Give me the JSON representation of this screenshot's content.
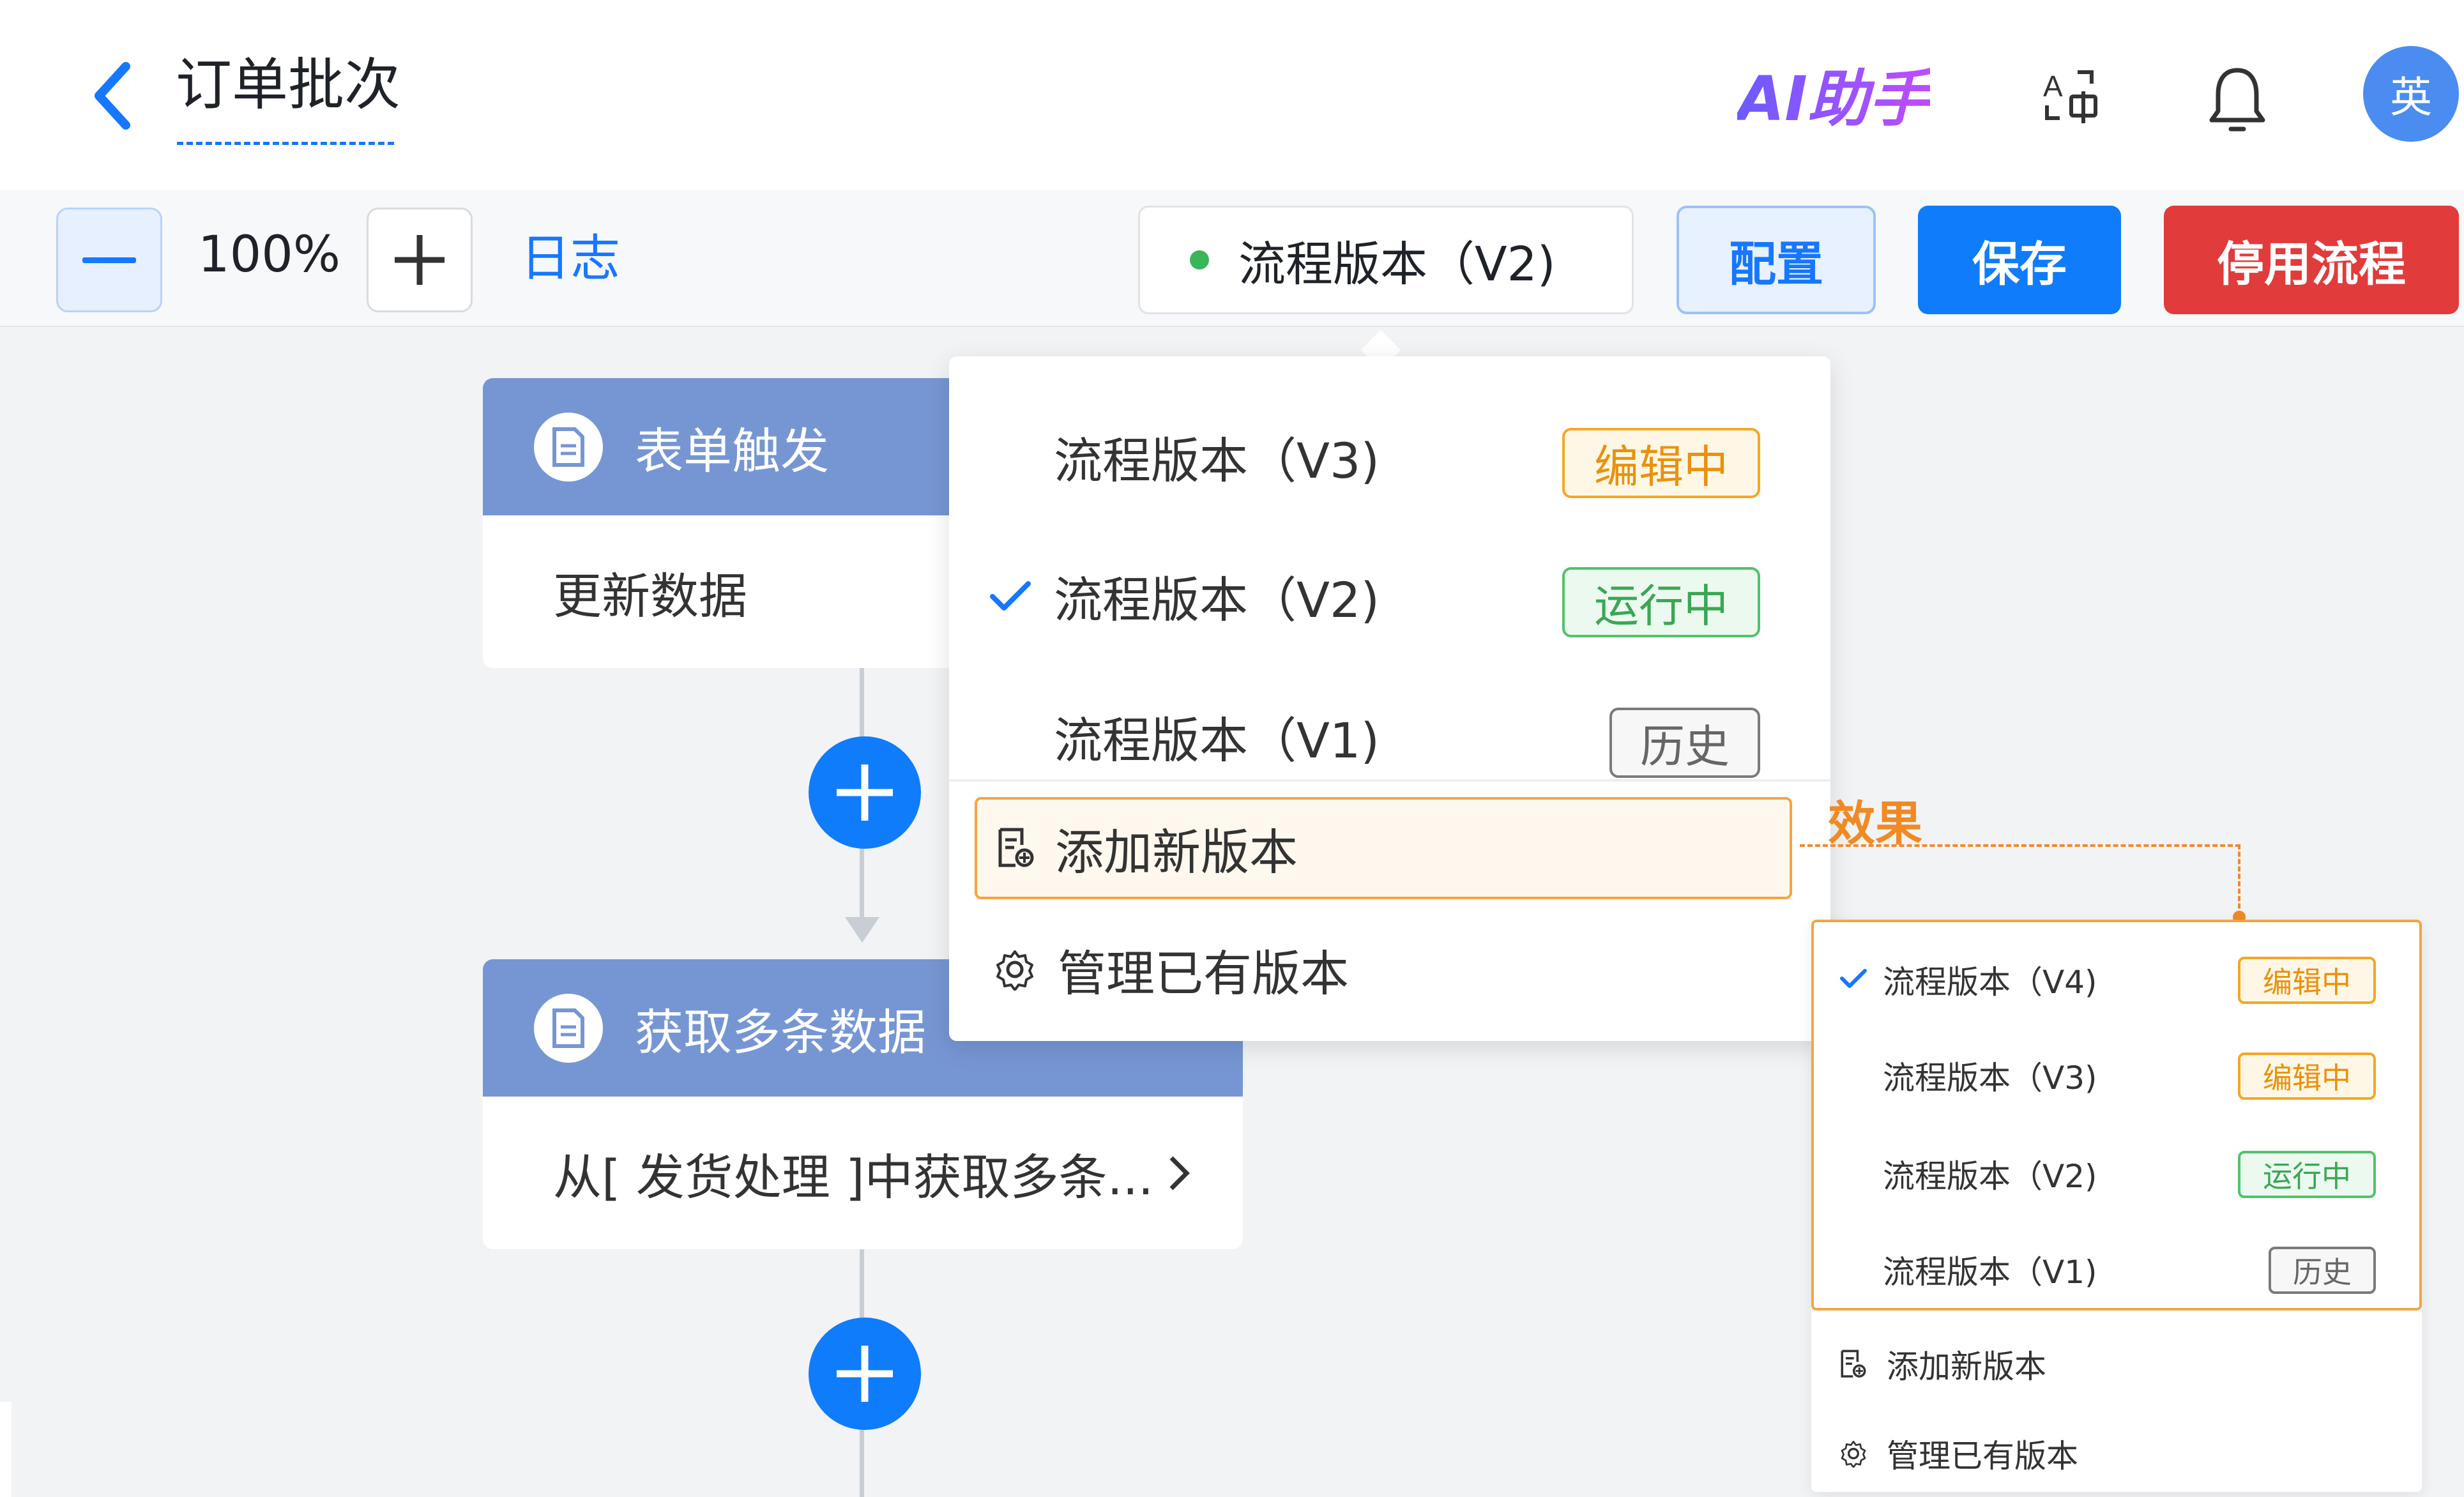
{
  "header": {
    "title": "订单批次",
    "ai_label": "AI助手",
    "avatar_text": "英"
  },
  "toolbar": {
    "zoom": "100%",
    "log_label": "日志",
    "version_label": "流程版本（V2)",
    "config_label": "配置",
    "save_label": "保存",
    "disable_label": "停用流程"
  },
  "nodes": [
    {
      "title": "表单触发",
      "body": "更新数据"
    },
    {
      "title": "获取多条数据",
      "body": "从[ 发货处理 ]中获取多条..."
    }
  ],
  "dropdown": {
    "versions": [
      {
        "label": "流程版本（V3)",
        "tag": "编辑中",
        "status": "editing"
      },
      {
        "label": "流程版本（V2)",
        "tag": "运行中",
        "status": "running",
        "selected": true
      },
      {
        "label": "流程版本（V1)",
        "tag": "历史",
        "status": "history"
      }
    ],
    "add_label": "添加新版本",
    "manage_label": "管理已有版本"
  },
  "annotation": {
    "label": "效果"
  },
  "mockup": {
    "versions": [
      {
        "label": "流程版本（V4)",
        "tag": "编辑中",
        "status": "editing",
        "selected": true
      },
      {
        "label": "流程版本（V3)",
        "tag": "编辑中",
        "status": "editing"
      },
      {
        "label": "流程版本（V2)",
        "tag": "运行中",
        "status": "running"
      },
      {
        "label": "流程版本（V1)",
        "tag": "历史",
        "status": "history"
      }
    ],
    "add_label": "添加新版本",
    "manage_label": "管理已有版本"
  },
  "colors": {
    "primary": "#0f7cfc",
    "danger": "#e23b3b",
    "node_header": "#7696d3",
    "editing": "#f5a623",
    "running": "#52c26b",
    "history": "#7a7a7a",
    "annotation": "#f08a24"
  }
}
